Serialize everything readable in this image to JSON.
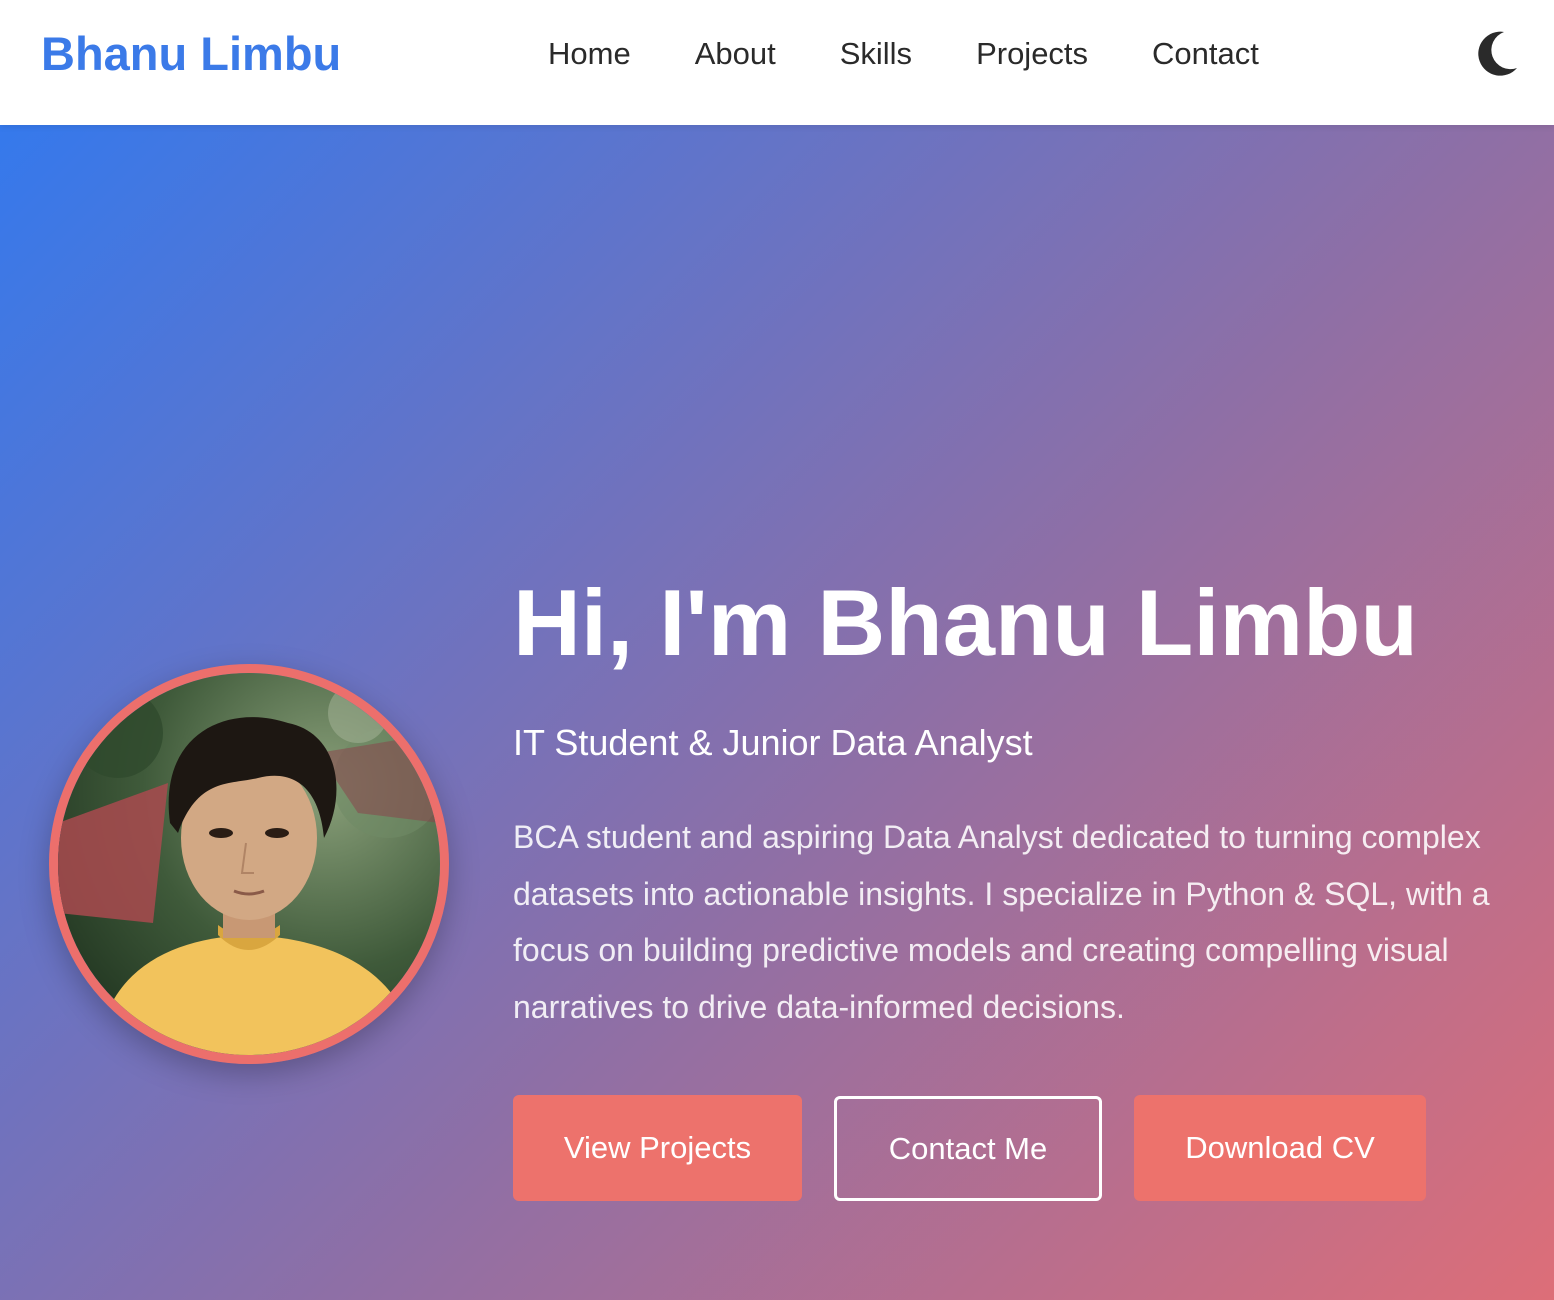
{
  "nav": {
    "logo": "Bhanu Limbu",
    "links": [
      "Home",
      "About",
      "Skills",
      "Projects",
      "Contact"
    ],
    "theme_toggle_icon": "moon-icon"
  },
  "hero": {
    "title": "Hi, I'm Bhanu Limbu",
    "subtitle": "IT Student & Junior Data Analyst",
    "description": "BCA student and aspiring Data Analyst dedicated to turning complex datasets into actionable insights. I specialize in Python & SQL, with a focus on building predictive models and creating compelling visual narratives to drive data-informed decisions.",
    "buttons": {
      "view_projects": "View Projects",
      "contact_me": "Contact Me",
      "download_cv": "Download CV"
    }
  },
  "colors": {
    "brand": "#3b7ae8",
    "accent": "#ed726c",
    "gradient_start": "#3579ec",
    "gradient_end": "#dd6e78"
  }
}
